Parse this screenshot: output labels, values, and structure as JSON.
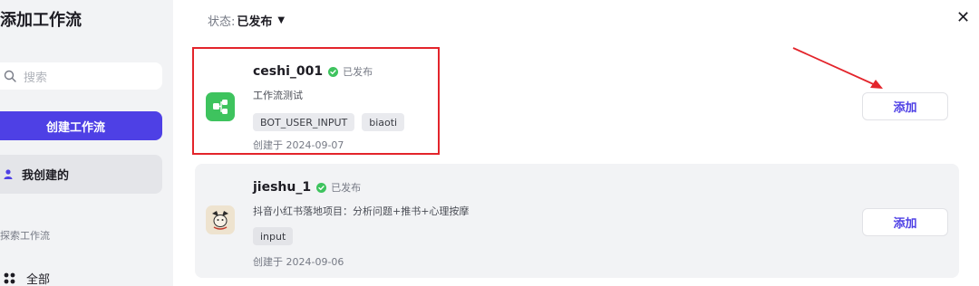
{
  "sidebar": {
    "title": "添加工作流",
    "search_placeholder": "搜索",
    "create_label": "创建工作流",
    "mine_label": "我创建的",
    "explore_label": "探索工作流",
    "all_label": "全部"
  },
  "filter": {
    "label": "状态:",
    "value": "已发布"
  },
  "workflows": [
    {
      "name": "ceshi_001",
      "status": "已发布",
      "description": "工作流测试",
      "tags": [
        "BOT_USER_INPUT",
        "biaoti"
      ],
      "created": "创建于 2024-09-07",
      "add_label": "添加",
      "icon": "workflow-icon"
    },
    {
      "name": "jieshu_1",
      "status": "已发布",
      "description": "抖音小红书落地项目：分析问题+推书+心理按摩",
      "tags": [
        "input"
      ],
      "created": "创建于 2024-09-06",
      "add_label": "添加",
      "icon": "cartoon-avatar-icon"
    }
  ],
  "colors": {
    "accent": "#4e40e5",
    "published_green": "#3ec35e",
    "annotation_red": "#e3242b"
  }
}
